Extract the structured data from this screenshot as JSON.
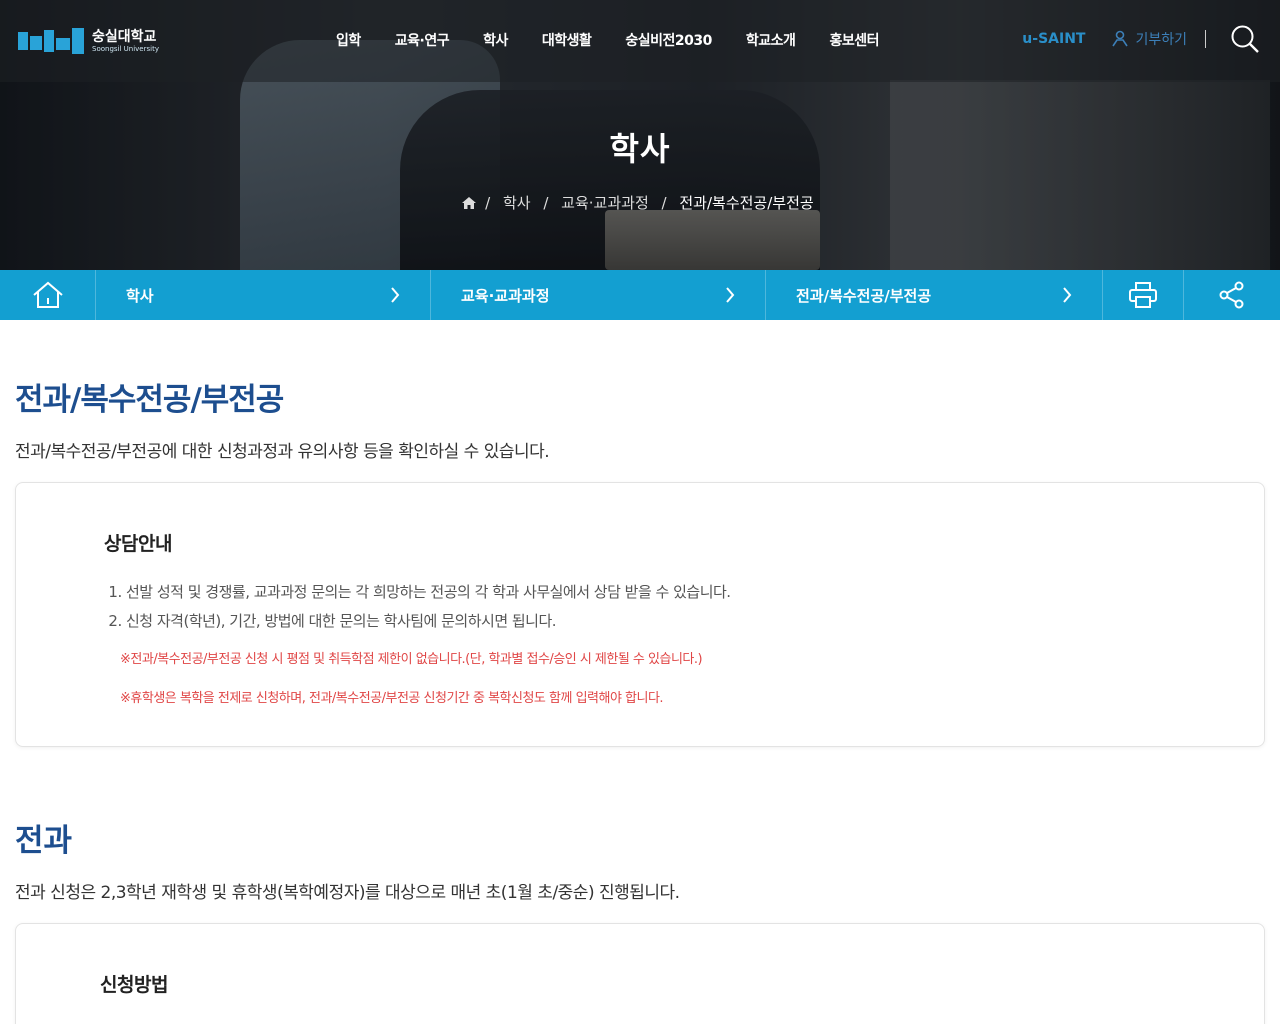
{
  "header": {
    "logo_ko": "숭실대학교",
    "logo_en": "Soongsil University",
    "nav": [
      "입학",
      "교육·연구",
      "학사",
      "대학생활",
      "숭실비전2030",
      "학교소개",
      "홍보센터"
    ],
    "usaint": "u-SAINT",
    "donate": "기부하기"
  },
  "hero": {
    "title": "학사",
    "breadcrumb": [
      "학사",
      "교육·교과과정",
      "전과/복수전공/부전공"
    ]
  },
  "navbar": {
    "seg1": "학사",
    "seg2": "교육·교과과정",
    "seg3": "전과/복수전공/부전공"
  },
  "section1": {
    "title": "전과/복수전공/부전공",
    "lead": "전과/복수전공/부전공에 대한 신청과정과 유의사항 등을 확인하실 수 있습니다.",
    "box_title": "상담안내",
    "items": [
      "선발 성적 및 경쟁률, 교과과정 문의는 각 희망하는 전공의 각 학과 사무실에서 상담 받을 수 있습니다.",
      "신청 자격(학년), 기간, 방법에 대한 문의는 학사팀에 문의하시면 됩니다."
    ],
    "notes": [
      "※전과/복수전공/부전공 신청 시 평점 및 취득학점 제한이 없습니다.(단, 학과별 접수/승인 시 제한될 수 있습니다.)",
      "※휴학생은 복학을 전제로 신청하며, 전과/복수전공/부전공 신청기간 중 복학신청도 함께 입력해야 합니다."
    ]
  },
  "section2": {
    "title": "전과",
    "lead": "전과 신청은 2,3학년 재학생 및 휴학생(복학예정자)를 대상으로 매년 초(1월 초/중순) 진행됩니다.",
    "box_title": "신청방법"
  },
  "colors": {
    "accent": "#139fd1",
    "heading": "#1d4e8f",
    "note": "#e04646"
  }
}
